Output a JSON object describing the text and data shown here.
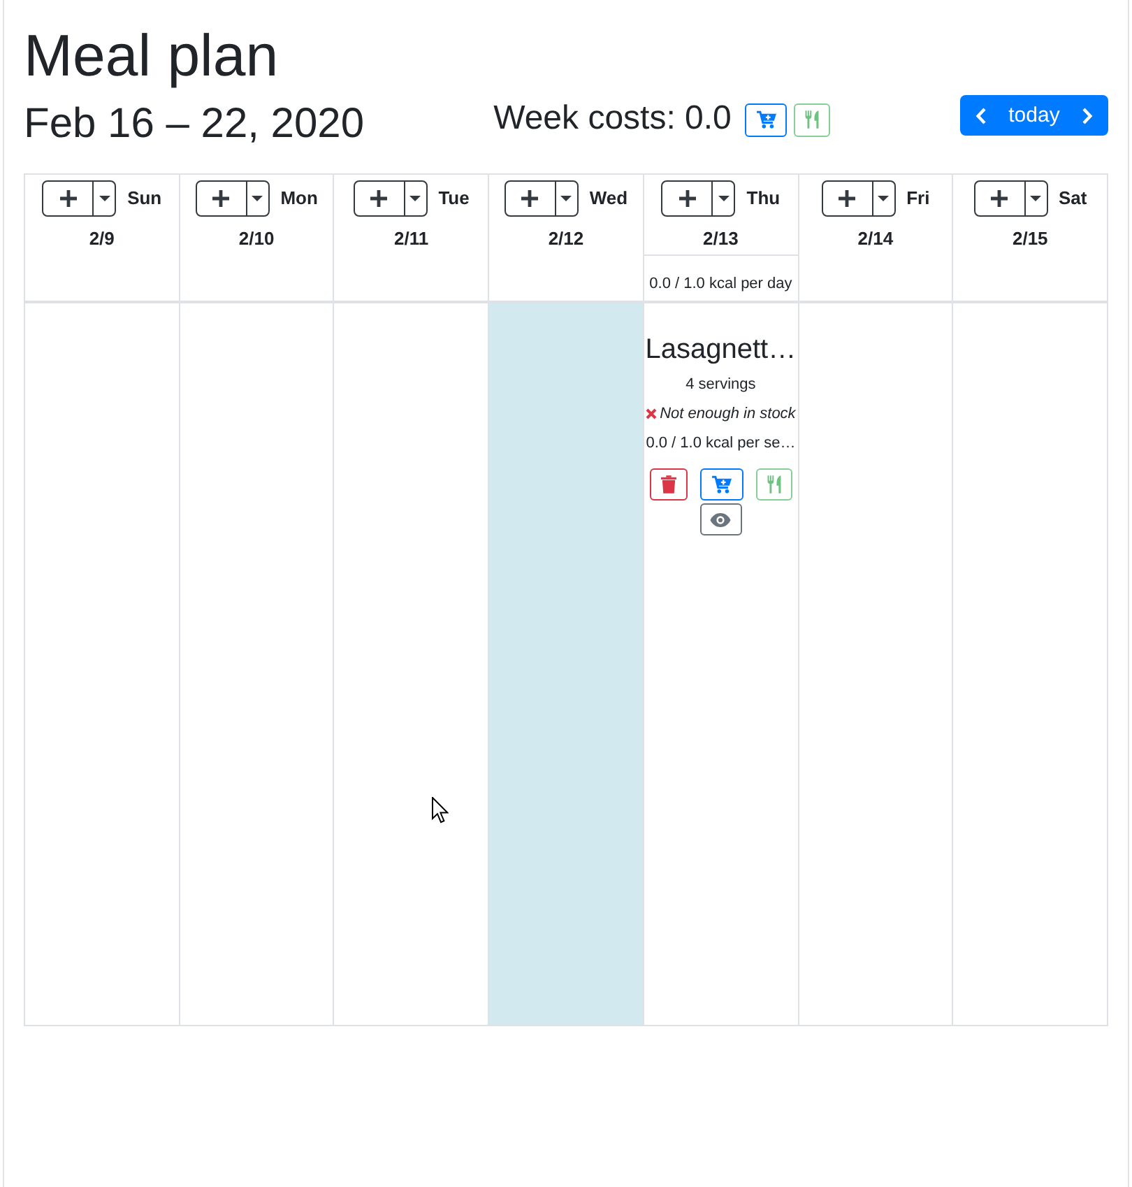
{
  "page": {
    "title": "Meal plan",
    "week_range": "Feb 16 – 22, 2020",
    "week_costs": "Week costs: 0.0"
  },
  "navigation": {
    "today": "today"
  },
  "days": [
    {
      "name": "Sun",
      "date": "2/9",
      "today": false
    },
    {
      "name": "Mon",
      "date": "2/10",
      "today": false
    },
    {
      "name": "Tue",
      "date": "2/11",
      "today": false
    },
    {
      "name": "Wed",
      "date": "2/12",
      "today": true
    },
    {
      "name": "Thu",
      "date": "2/13",
      "today": false,
      "summary": "0.0 / 1.0 kcal per day",
      "meals": [
        {
          "title": "Lasagnett…",
          "servings": "4 servings",
          "in_stock": false,
          "stock_note": "Not enough in stock",
          "calories": "0.0 / 1.0 kcal per se…"
        }
      ]
    },
    {
      "name": "Fri",
      "date": "2/14",
      "today": false
    },
    {
      "name": "Sat",
      "date": "2/15",
      "today": false
    }
  ]
}
